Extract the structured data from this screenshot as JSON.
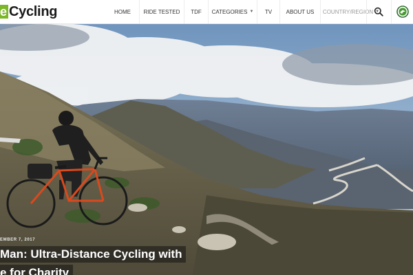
{
  "logo": {
    "mark": "e",
    "word": "Cycling"
  },
  "nav": {
    "home": "HOME",
    "ride_tested": "RIDE TESTED",
    "tdf": "TDF",
    "categories": "CATEGORIES",
    "tv": "TV",
    "about_us": "ABOUT US",
    "country_region": "COUNTRY/REGION"
  },
  "header_icons": {
    "search": "search-icon",
    "brand": "skoda-logo-icon"
  },
  "hero": {
    "date": "EMBER 7, 2017",
    "headline_line1": "Man: Ultra-Distance Cycling with",
    "headline_line2": "e for Charity"
  },
  "colors": {
    "accent": "#7bb728",
    "bike_frame": "#d94a1e"
  }
}
